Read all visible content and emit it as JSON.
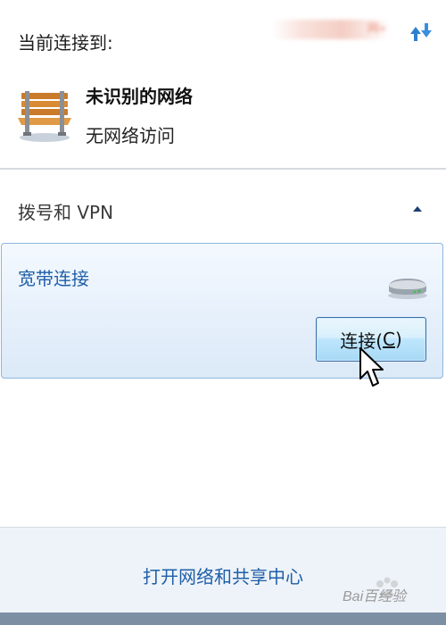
{
  "header": {
    "title": "当前连接到:",
    "blurred_text": "网»",
    "refresh_icon": "network-refresh-icon"
  },
  "network": {
    "icon": "park-bench-icon",
    "name": "未识别的网络",
    "status": "无网络访问"
  },
  "dialup_section": {
    "title": "拨号和 VPN",
    "collapse_icon": "chevron-up-icon"
  },
  "broadband": {
    "name": "宽带连接",
    "icon": "modem-icon",
    "button_label_main": "连接(",
    "button_label_accel": "C",
    "button_label_end": ")"
  },
  "footer": {
    "link": "打开网络和共享中心"
  },
  "watermark": {
    "text": "Bai百经验"
  },
  "colors": {
    "link_blue": "#1f5fa8",
    "card_border": "#8fb6df",
    "button_border": "#3c6fa5"
  }
}
